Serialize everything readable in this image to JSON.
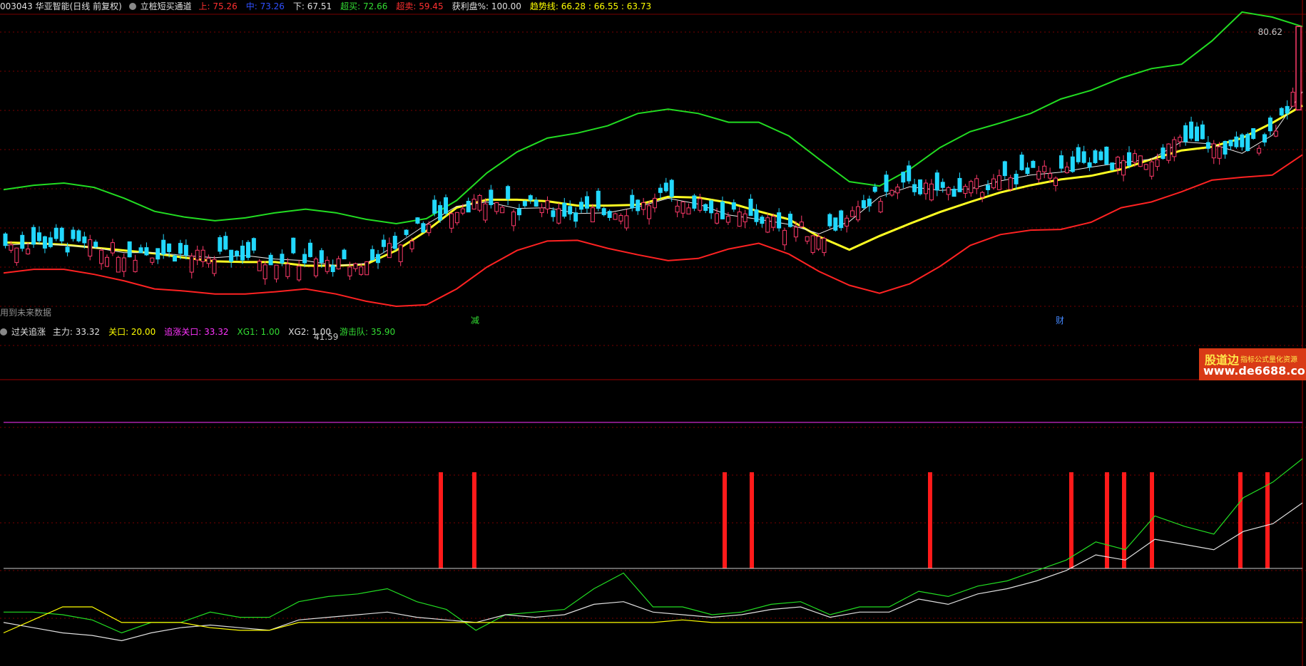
{
  "header_main": {
    "stock": "003043 华亚智能(日线 前复权)",
    "indicator": "立桩短买通道",
    "items": [
      {
        "label": "上: ",
        "value": "75.26",
        "color": "#ff3030"
      },
      {
        "label": "中: ",
        "value": "73.26",
        "color": "#3050ff"
      },
      {
        "label": "下: ",
        "value": "67.51",
        "color": "#e0e0e0"
      },
      {
        "label": "超买: ",
        "value": "72.66",
        "color": "#33dd33"
      },
      {
        "label": "超卖: ",
        "value": "59.45",
        "color": "#ff3030"
      },
      {
        "label": "获利盘%: ",
        "value": "100.00",
        "color": "#e0e0e0"
      },
      {
        "label": "趋势线: ",
        "value": "66.28 : 66.55 : 63.73",
        "color": "#ffff00"
      }
    ]
  },
  "header_sub": {
    "indicator": "过关追涨",
    "items": [
      {
        "label": "主力: ",
        "value": "33.32",
        "color": "#e0e0e0"
      },
      {
        "label": "关口: ",
        "value": "20.00",
        "color": "#ffff00"
      },
      {
        "label": "追涨关口: ",
        "value": "33.32",
        "color": "#ff33ff"
      },
      {
        "label": "XG1: ",
        "value": "1.00",
        "color": "#33dd33"
      },
      {
        "label": "XG2: ",
        "value": "1.00",
        "color": "#e0e0e0"
      },
      {
        "label": "游击队: ",
        "value": "35.90",
        "color": "#33dd33"
      }
    ]
  },
  "future_note": "用到未来数据",
  "marker_jian": "减",
  "marker_cai": "财",
  "watermark": {
    "line1": "股道边",
    "line1b": "指标公式量化资源",
    "line2": "www.de6688.com"
  },
  "price_labels": {
    "high": "80.62",
    "low": "41.59"
  },
  "chart_data": {
    "type": "line",
    "main": {
      "ylim": [
        38,
        84
      ],
      "series": [
        {
          "color": "#22dd22",
          "values": [
            60,
            60.6,
            60.9,
            60.3,
            58.8,
            57,
            56.2,
            55.7,
            56.1,
            56.8,
            57.3,
            56.8,
            55.9,
            55.3,
            56,
            58.5,
            62.3,
            65.2,
            67.1,
            67.8,
            68.8,
            70.5,
            71.1,
            70.5,
            69.3,
            69.3,
            67.4,
            64.2,
            61.1,
            60.5,
            62.8,
            65.8,
            68,
            69.2,
            70.5,
            72.5,
            73.7,
            75.4,
            76.7,
            77.3,
            80.5,
            84.5,
            83.8,
            82.5
          ]
        },
        {
          "color": "#ff2222",
          "values": [
            48.5,
            49,
            49,
            48.3,
            47.4,
            46.3,
            46,
            45.6,
            45.6,
            45.9,
            46.3,
            45.6,
            44.6,
            43.9,
            44.1,
            46.3,
            49.3,
            51.6,
            52.9,
            53,
            51.9,
            51,
            50.2,
            50.5,
            51.8,
            52.6,
            51.1,
            48.7,
            46.8,
            45.7,
            47,
            49.4,
            52.3,
            53.8,
            54.4,
            54.5,
            55.5,
            57.5,
            58.3,
            59.7,
            61.3,
            61.7,
            62,
            64.8
          ]
        },
        {
          "color": "#ffff22",
          "values": [
            52.7,
            52.6,
            52.4,
            52,
            51.6,
            51.2,
            50.6,
            50.1,
            50,
            50,
            49.5,
            49.5,
            49.7,
            51.6,
            54.3,
            57.5,
            58.6,
            58.6,
            58.4,
            57.8,
            57.8,
            57.9,
            59,
            58.9,
            58.2,
            57,
            55.9,
            53.5,
            51.7,
            53.6,
            55.3,
            56.9,
            58.3,
            59.6,
            60.6,
            61.4,
            61.9,
            62.8,
            64.2,
            65.4,
            65.9,
            67.1,
            69.2,
            71.6
          ]
        },
        {
          "color": "#e8e8e8",
          "values": [
            52.3,
            52.6,
            52.3,
            52,
            51.3,
            51.3,
            50.9,
            50.6,
            50.9,
            50.4,
            50.2,
            49.5,
            49.8,
            52.4,
            55.2,
            57.7,
            58.3,
            57.4,
            57.5,
            56.7,
            56.8,
            57.6,
            58.8,
            58,
            56.5,
            55.9,
            55.2,
            53.9,
            55.6,
            59,
            60.4,
            59.9,
            60.1,
            61.2,
            62,
            62.4,
            63.1,
            63.7,
            64.2,
            66.6,
            66.3,
            65,
            67.5,
            73.5
          ]
        }
      ]
    },
    "sub": {
      "ylim": [
        0,
        100
      ],
      "series": [
        {
          "color": "#22dd22",
          "values": [
            18,
            18,
            17,
            15,
            10,
            14,
            14,
            18,
            16,
            16,
            22,
            24,
            25,
            27,
            22,
            19,
            11,
            17,
            18,
            19,
            27,
            33,
            20,
            20,
            17,
            18,
            21,
            22,
            17,
            20,
            20,
            26,
            24,
            28,
            30,
            34,
            38,
            45,
            42,
            55,
            51,
            48,
            62,
            68,
            77
          ]
        },
        {
          "color": "#e0e0e0",
          "values": [
            14,
            12,
            10,
            9,
            7,
            10,
            12,
            13,
            12,
            11,
            15,
            16,
            17,
            18,
            16,
            15,
            14,
            17,
            16,
            17,
            21,
            22,
            18,
            17,
            16,
            17,
            19,
            20,
            16,
            18,
            18,
            23,
            21,
            25,
            27,
            30,
            34,
            40,
            38,
            46,
            44,
            42,
            49,
            52,
            60
          ]
        },
        {
          "color": "#ffff00",
          "values": [
            10,
            15,
            20,
            20,
            14,
            14,
            14,
            12,
            11,
            11,
            14,
            14,
            14,
            14,
            14,
            14,
            14,
            14,
            14,
            14,
            14,
            14,
            14,
            15,
            14,
            14,
            14,
            14,
            14,
            14,
            14,
            14,
            14,
            14,
            14,
            14,
            14,
            14,
            14,
            14,
            14,
            14,
            14,
            14,
            14
          ]
        }
      ]
    }
  }
}
